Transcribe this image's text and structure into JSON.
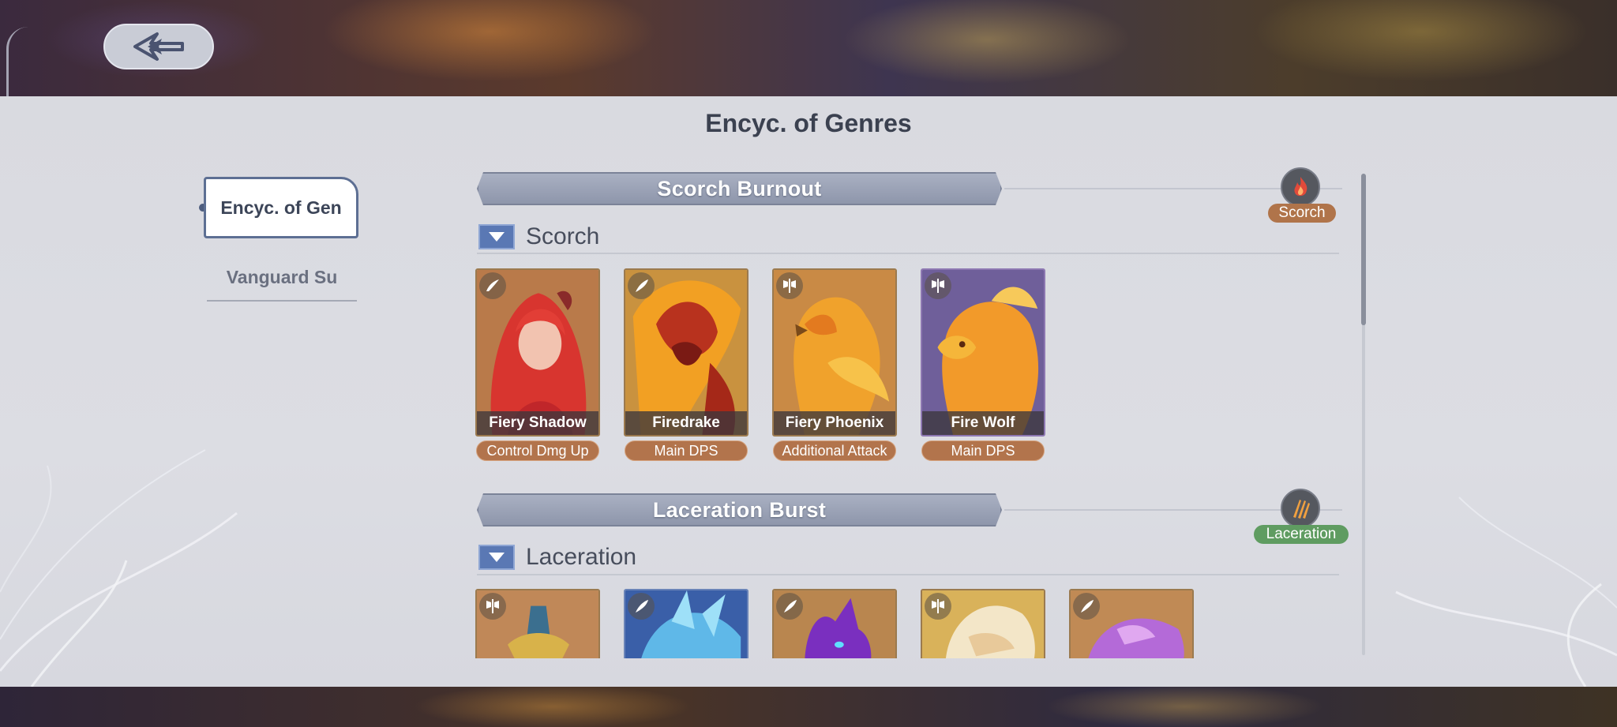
{
  "back_button": {
    "icon": "back-arrow-icon"
  },
  "panel": {
    "title": "Encyc. of Genres"
  },
  "sidebar": {
    "tabs": [
      {
        "label": "Encyc. of Gen",
        "active": true
      },
      {
        "label": "Vanguard Su",
        "active": false
      }
    ]
  },
  "genres": [
    {
      "banner": "Scorch Burnout",
      "badge": "Scorch",
      "badge_color": "#b0744a",
      "section": "Scorch",
      "heroes": [
        {
          "name": "Fiery Shadow",
          "role": "Control Dmg Up",
          "class_icon": "wing-icon"
        },
        {
          "name": "Firedrake",
          "role": "Main DPS",
          "class_icon": "feather-icon"
        },
        {
          "name": "Fiery Phoenix",
          "role": "Additional Attack",
          "class_icon": "axe-icon"
        },
        {
          "name": "Fire Wolf",
          "role": "Main DPS",
          "class_icon": "axe-icon"
        }
      ]
    },
    {
      "banner": "Laceration Burst",
      "badge": "Laceration",
      "badge_color": "#5f9c61",
      "section": "Laceration",
      "heroes": [
        {
          "class_icon": "axe-icon"
        },
        {
          "class_icon": "feather-icon"
        },
        {
          "class_icon": "feather-icon"
        },
        {
          "class_icon": "axe-icon"
        },
        {
          "class_icon": "feather-icon"
        }
      ]
    }
  ]
}
